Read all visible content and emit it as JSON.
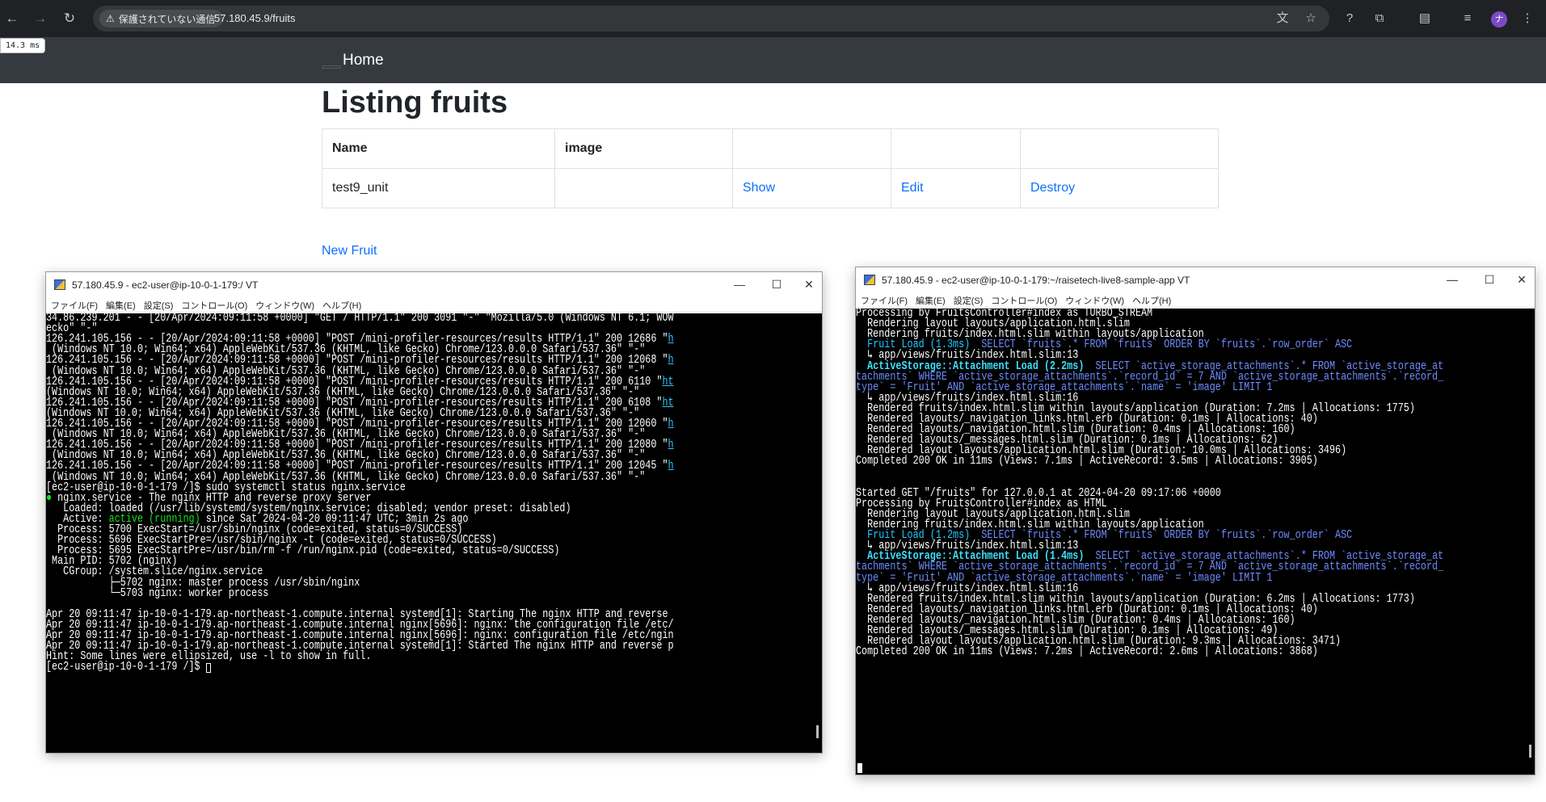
{
  "browser": {
    "security_label": "保護されていない通信",
    "url": "57.180.45.9/fruits",
    "profile_initial": "ナ"
  },
  "profiler_badge": "14.3 ms",
  "navbar": {
    "home": "Home"
  },
  "page": {
    "title": "Listing fruits",
    "table": {
      "headers": [
        "Name",
        "image",
        "",
        "",
        ""
      ],
      "rows": [
        {
          "name": "test9_unit",
          "image": "",
          "show": "Show",
          "edit": "Edit",
          "destroy": "Destroy"
        }
      ]
    },
    "new_link": "New Fruit"
  },
  "left_window": {
    "title": "57.180.45.9 - ec2-user@ip-10-0-1-179:/ VT",
    "menu": [
      "ファイル(F)",
      "編集(E)",
      "設定(S)",
      "コントロール(O)",
      "ウィンドウ(W)",
      "ヘルプ(H)"
    ],
    "controls": {
      "minimize": "—",
      "maximize": "☐",
      "close": "✕"
    },
    "lines": [
      [
        {
          "t": "34.86.239.201 - - [20/Apr/2024:09:11:58 +0000] \"GET / HTTP/1.1\" 200 3091 \"-\" \"Mozilla/5.0 (Windows NT 6.1; WOW"
        }
      ],
      [
        {
          "t": "ecko\" \"-\""
        }
      ],
      [
        {
          "t": "126.241.105.156 - - [20/Apr/2024:09:11:58 +0000] \"POST /mini-profiler-resources/results HTTP/1.1\" 200 12686 \""
        },
        {
          "t": "h",
          "c": "c-lnk"
        }
      ],
      [
        {
          "t": " (Windows NT 10.0; Win64; x64) AppleWebKit/537.36 (KHTML, like Gecko) Chrome/123.0.0.0 Safari/537.36\" \"-\""
        }
      ],
      [
        {
          "t": "126.241.105.156 - - [20/Apr/2024:09:11:58 +0000] \"POST /mini-profiler-resources/results HTTP/1.1\" 200 12068 \""
        },
        {
          "t": "h",
          "c": "c-lnk"
        }
      ],
      [
        {
          "t": " (Windows NT 10.0; Win64; x64) AppleWebKit/537.36 (KHTML, like Gecko) Chrome/123.0.0.0 Safari/537.36\" \"-\""
        }
      ],
      [
        {
          "t": "126.241.105.156 - - [20/Apr/2024:09:11:58 +0000] \"POST /mini-profiler-resources/results HTTP/1.1\" 200 6110 \""
        },
        {
          "t": "ht",
          "c": "c-lnk"
        }
      ],
      [
        {
          "t": "(Windows NT 10.0; Win64; x64) AppleWebKit/537.36 (KHTML, like Gecko) Chrome/123.0.0.0 Safari/537.36\" \"-\""
        }
      ],
      [
        {
          "t": "126.241.105.156 - - [20/Apr/2024:09:11:58 +0000] \"POST /mini-profiler-resources/results HTTP/1.1\" 200 6108 \""
        },
        {
          "t": "ht",
          "c": "c-lnk"
        }
      ],
      [
        {
          "t": "(Windows NT 10.0; Win64; x64) AppleWebKit/537.36 (KHTML, like Gecko) Chrome/123.0.0.0 Safari/537.36\" \"-\""
        }
      ],
      [
        {
          "t": "126.241.105.156 - - [20/Apr/2024:09:11:58 +0000] \"POST /mini-profiler-resources/results HTTP/1.1\" 200 12060 \""
        },
        {
          "t": "h",
          "c": "c-lnk"
        }
      ],
      [
        {
          "t": " (Windows NT 10.0; Win64; x64) AppleWebKit/537.36 (KHTML, like Gecko) Chrome/123.0.0.0 Safari/537.36\" \"-\""
        }
      ],
      [
        {
          "t": "126.241.105.156 - - [20/Apr/2024:09:11:58 +0000] \"POST /mini-profiler-resources/results HTTP/1.1\" 200 12080 \""
        },
        {
          "t": "h",
          "c": "c-lnk"
        }
      ],
      [
        {
          "t": " (Windows NT 10.0; Win64; x64) AppleWebKit/537.36 (KHTML, like Gecko) Chrome/123.0.0.0 Safari/537.36\" \"-\""
        }
      ],
      [
        {
          "t": "126.241.105.156 - - [20/Apr/2024:09:11:58 +0000] \"POST /mini-profiler-resources/results HTTP/1.1\" 200 12045 \""
        },
        {
          "t": "h",
          "c": "c-lnk"
        }
      ],
      [
        {
          "t": " (Windows NT 10.0; Win64; x64) AppleWebKit/537.36 (KHTML, like Gecko) Chrome/123.0.0.0 Safari/537.36\" \"-\""
        }
      ],
      [
        {
          "t": "[ec2-user@ip-10-0-1-179 /]$ sudo systemctl status nginx.service"
        }
      ],
      [
        {
          "t": "● ",
          "c": "c-green"
        },
        {
          "t": "nginx.service - The nginx HTTP and reverse proxy server"
        }
      ],
      [
        {
          "t": "   Loaded: loaded (/usr/lib/systemd/system/nginx.service; disabled; vendor preset: disabled)"
        }
      ],
      [
        {
          "t": "   Active: "
        },
        {
          "t": "active (running)",
          "c": "c-green"
        },
        {
          "t": " since Sat 2024-04-20 09:11:47 UTC; 3min 2s ago"
        }
      ],
      [
        {
          "t": "  Process: 5700 ExecStart=/usr/sbin/nginx (code=exited, status=0/SUCCESS)"
        }
      ],
      [
        {
          "t": "  Process: 5696 ExecStartPre=/usr/sbin/nginx -t (code=exited, status=0/SUCCESS)"
        }
      ],
      [
        {
          "t": "  Process: 5695 ExecStartPre=/usr/bin/rm -f /run/nginx.pid (code=exited, status=0/SUCCESS)"
        }
      ],
      [
        {
          "t": " Main PID: 5702 (nginx)"
        }
      ],
      [
        {
          "t": "   CGroup: /system.slice/nginx.service"
        }
      ],
      [
        {
          "t": "           ├─5702 nginx: master process /usr/sbin/nginx"
        }
      ],
      [
        {
          "t": "           └─5703 nginx: worker process"
        }
      ],
      [
        {
          "t": ""
        }
      ],
      [
        {
          "t": "Apr 20 09:11:47 ip-10-0-1-179.ap-northeast-1.compute.internal systemd[1]: Starting The nginx HTTP and reverse"
        }
      ],
      [
        {
          "t": "Apr 20 09:11:47 ip-10-0-1-179.ap-northeast-1.compute.internal nginx[5696]: nginx: the configuration file /etc/"
        }
      ],
      [
        {
          "t": "Apr 20 09:11:47 ip-10-0-1-179.ap-northeast-1.compute.internal nginx[5696]: nginx: configuration file /etc/ngin"
        }
      ],
      [
        {
          "t": "Apr 20 09:11:47 ip-10-0-1-179.ap-northeast-1.compute.internal systemd[1]: Started The nginx HTTP and reverse p"
        }
      ],
      [
        {
          "t": "Hint: Some lines were ellipsized, use -l to show in full."
        }
      ],
      [
        {
          "t": "[ec2-user@ip-10-0-1-179 /]$ "
        }
      ]
    ]
  },
  "right_window": {
    "title": "57.180.45.9 - ec2-user@ip-10-0-1-179:~/raisetech-live8-sample-app VT",
    "menu": [
      "ファイル(F)",
      "編集(E)",
      "設定(S)",
      "コントロール(O)",
      "ウィンドウ(W)",
      "ヘルプ(H)"
    ],
    "controls": {
      "minimize": "—",
      "maximize": "☐",
      "close": "✕"
    },
    "lines": [
      [
        {
          "t": "Processing by FruitsController#index as TURBO_STREAM"
        }
      ],
      [
        {
          "t": "  Rendering layout layouts/application.html.slim"
        }
      ],
      [
        {
          "t": "  Rendering fruits/index.html.slim within layouts/application"
        }
      ],
      [
        {
          "t": "  "
        },
        {
          "t": "Fruit Load (1.3ms)",
          "c": "c-cyan"
        },
        {
          "t": "  SELECT `fruits`.* FROM `fruits` ORDER BY `fruits`.`row_order` ASC",
          "c": "c-sel"
        }
      ],
      [
        {
          "t": "  ↳ app/views/fruits/index.html.slim:13"
        }
      ],
      [
        {
          "t": "  "
        },
        {
          "t": "ActiveStorage::Attachment Load (2.2ms)",
          "c": "c-ar"
        },
        {
          "t": "  SELECT `active_storage_attachments`.* FROM `active_storage_at",
          "c": "c-sel"
        }
      ],
      [
        {
          "t": "tachments` WHERE `active_storage_attachments`.`record_id` = 7 AND `active_storage_attachments`.`record_",
          "c": "c-sel"
        }
      ],
      [
        {
          "t": "type` = 'Fruit' AND `active_storage_attachments`.`name` = 'image' LIMIT 1",
          "c": "c-sel"
        }
      ],
      [
        {
          "t": "  ↳ app/views/fruits/index.html.slim:16"
        }
      ],
      [
        {
          "t": "  Rendered fruits/index.html.slim within layouts/application (Duration: 7.2ms | Allocations: 1775)"
        }
      ],
      [
        {
          "t": "  Rendered layouts/_navigation_links.html.erb (Duration: 0.1ms | Allocations: 40)"
        }
      ],
      [
        {
          "t": "  Rendered layouts/_navigation.html.slim (Duration: 0.4ms | Allocations: 160)"
        }
      ],
      [
        {
          "t": "  Rendered layouts/_messages.html.slim (Duration: 0.1ms | Allocations: 62)"
        }
      ],
      [
        {
          "t": "  Rendered layout layouts/application.html.slim (Duration: 10.0ms | Allocations: 3496)"
        }
      ],
      [
        {
          "t": "Completed 200 OK in 11ms (Views: 7.1ms | ActiveRecord: 3.5ms | Allocations: 3905)"
        }
      ],
      [
        {
          "t": ""
        }
      ],
      [
        {
          "t": ""
        }
      ],
      [
        {
          "t": "Started GET \"/fruits\" for 127.0.0.1 at 2024-04-20 09:17:06 +0000"
        }
      ],
      [
        {
          "t": "Processing by FruitsController#index as HTML"
        }
      ],
      [
        {
          "t": "  Rendering layout layouts/application.html.slim"
        }
      ],
      [
        {
          "t": "  Rendering fruits/index.html.slim within layouts/application"
        }
      ],
      [
        {
          "t": "  "
        },
        {
          "t": "Fruit Load (1.2ms)",
          "c": "c-cyan"
        },
        {
          "t": "  SELECT `fruits`.* FROM `fruits` ORDER BY `fruits`.`row_order` ASC",
          "c": "c-sel"
        }
      ],
      [
        {
          "t": "  ↳ app/views/fruits/index.html.slim:13"
        }
      ],
      [
        {
          "t": "  "
        },
        {
          "t": "ActiveStorage::Attachment Load (1.4ms)",
          "c": "c-ar"
        },
        {
          "t": "  SELECT `active_storage_attachments`.* FROM `active_storage_at",
          "c": "c-sel"
        }
      ],
      [
        {
          "t": "tachments` WHERE `active_storage_attachments`.`record_id` = 7 AND `active_storage_attachments`.`record_",
          "c": "c-sel"
        }
      ],
      [
        {
          "t": "type` = 'Fruit' AND `active_storage_attachments`.`name` = 'image' LIMIT 1",
          "c": "c-sel"
        }
      ],
      [
        {
          "t": "  ↳ app/views/fruits/index.html.slim:16"
        }
      ],
      [
        {
          "t": "  Rendered fruits/index.html.slim within layouts/application (Duration: 6.2ms | Allocations: 1773)"
        }
      ],
      [
        {
          "t": "  Rendered layouts/_navigation_links.html.erb (Duration: 0.1ms | Allocations: 40)"
        }
      ],
      [
        {
          "t": "  Rendered layouts/_navigation.html.slim (Duration: 0.4ms | Allocations: 160)"
        }
      ],
      [
        {
          "t": "  Rendered layouts/_messages.html.slim (Duration: 0.1ms | Allocations: 49)"
        }
      ],
      [
        {
          "t": "  Rendered layout layouts/application.html.slim (Duration: 9.3ms | Allocations: 3471)"
        }
      ],
      [
        {
          "t": "Completed 200 OK in 11ms (Views: 7.2ms | ActiveRecord: 2.6ms | Allocations: 3868)"
        }
      ]
    ]
  }
}
